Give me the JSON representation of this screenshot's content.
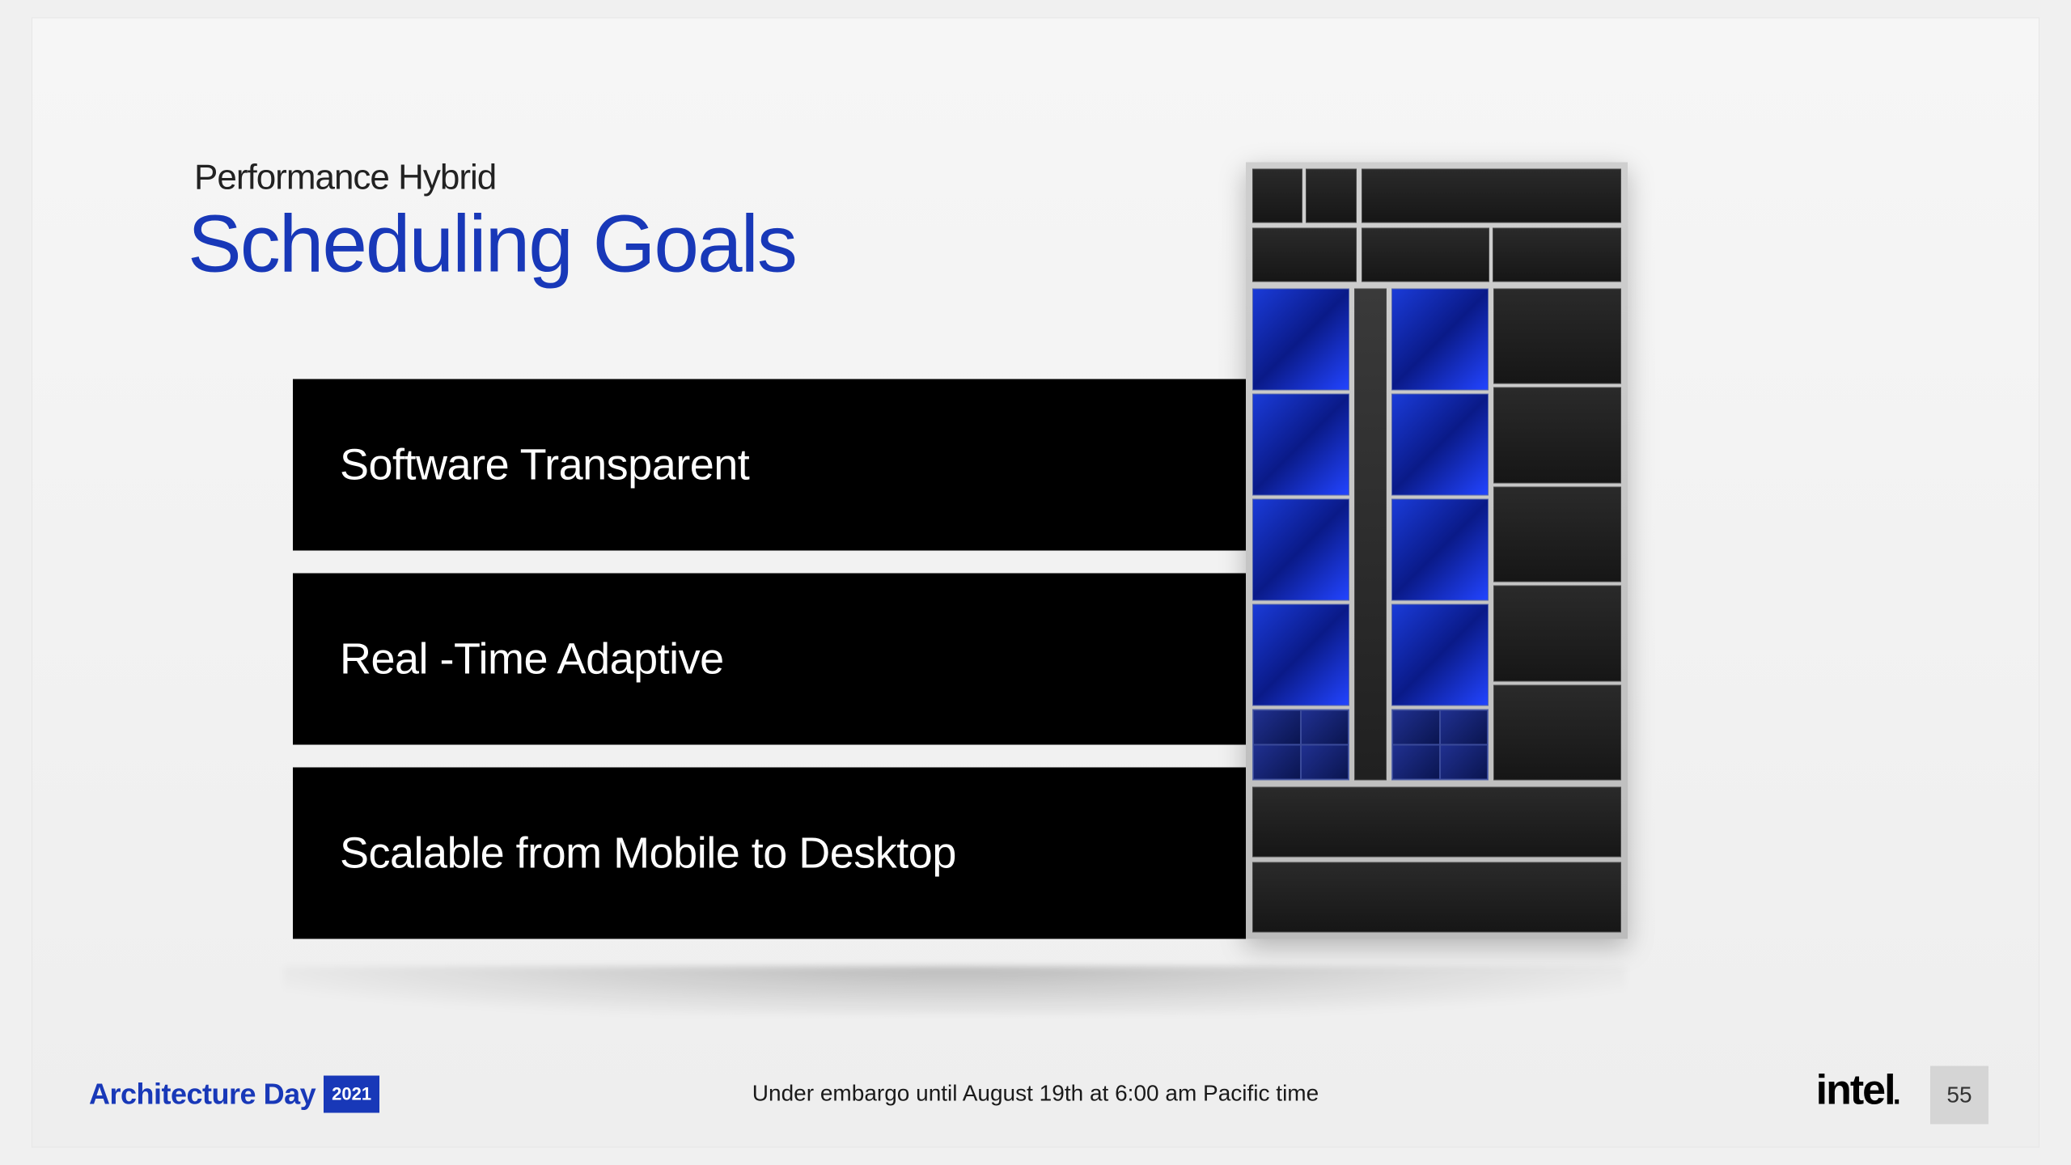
{
  "header": {
    "subtitle": "Performance Hybrid",
    "title": "Scheduling Goals"
  },
  "goals": [
    "Software Transparent",
    "Real -Time Adaptive",
    "Scalable from Mobile to Desktop"
  ],
  "footer": {
    "event": "Architecture Day",
    "year": "2021",
    "embargo": "Under embargo until August 19th at 6:00 am Pacific time",
    "brand": "intel",
    "page": "55"
  }
}
